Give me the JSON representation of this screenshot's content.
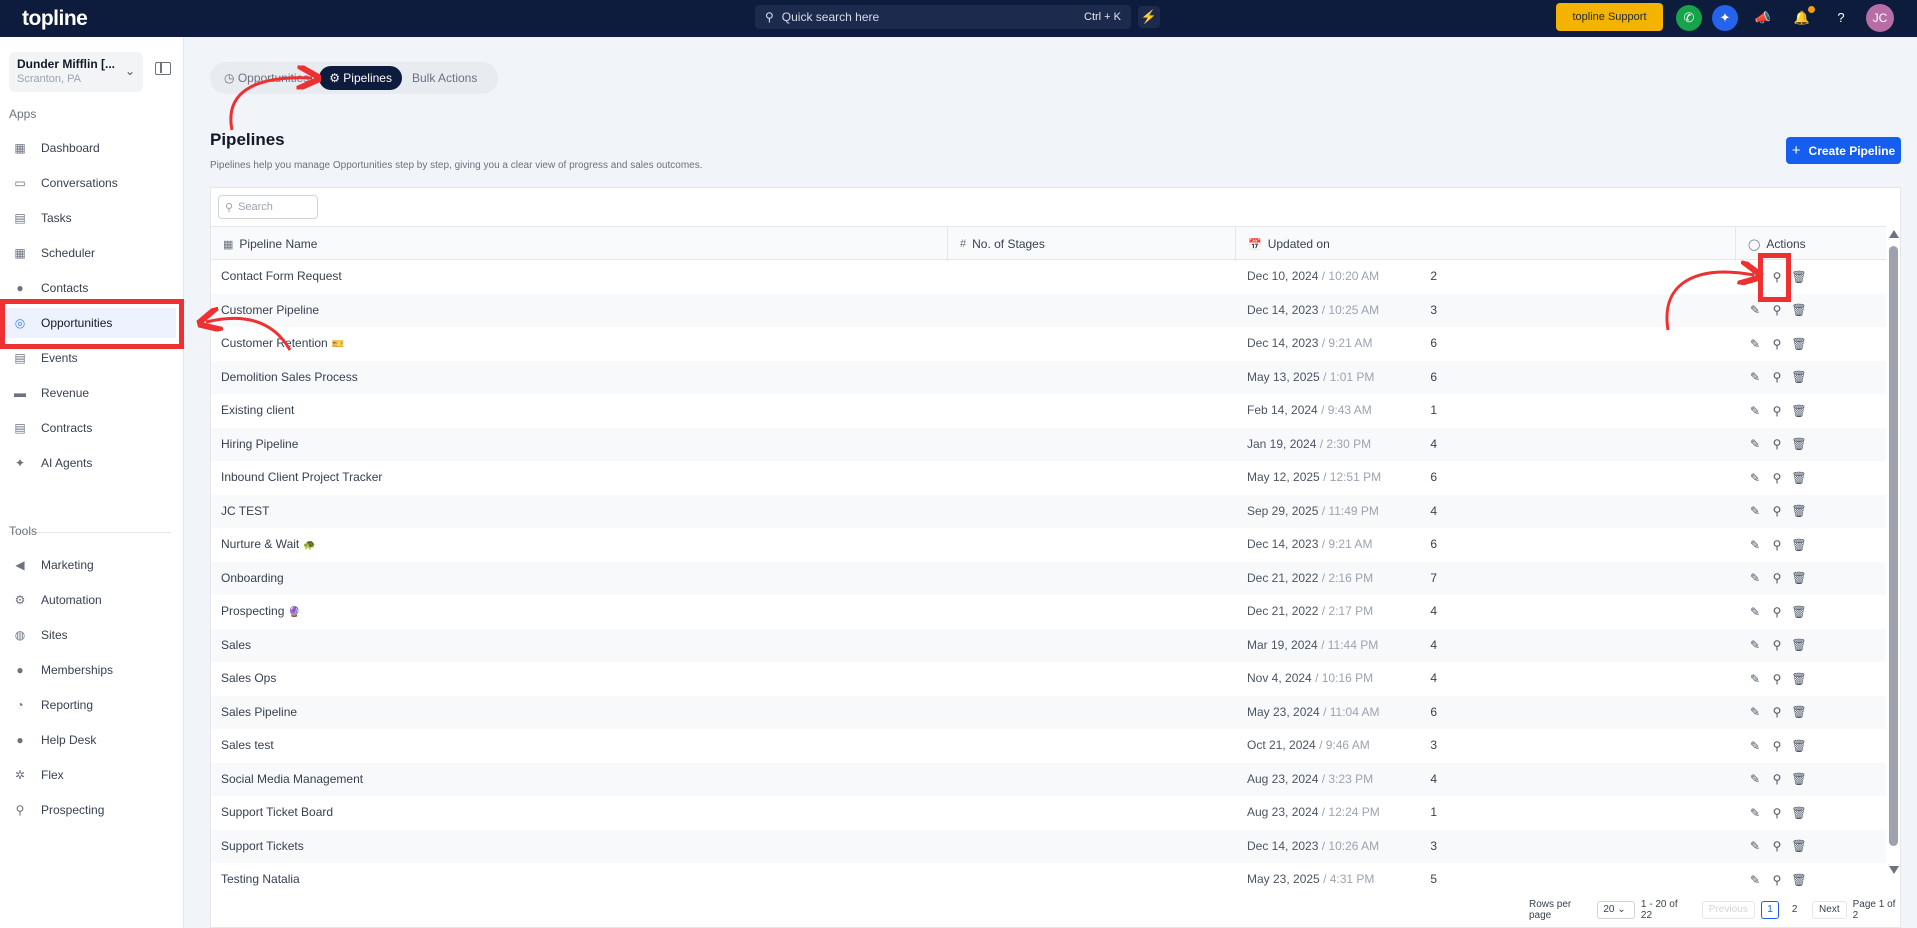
{
  "topbar": {
    "logo": "topline",
    "search_placeholder": "Quick search here",
    "search_shortcut": "Ctrl + K",
    "support_label": "topline Support",
    "avatar_initials": "JC"
  },
  "account": {
    "name": "Dunder Mifflin [...",
    "location": "Scranton, PA"
  },
  "sidebar": {
    "apps_label": "Apps",
    "tools_label": "Tools",
    "apps": [
      {
        "label": "Dashboard",
        "icon": "dashboard-icon"
      },
      {
        "label": "Conversations",
        "icon": "chat-icon"
      },
      {
        "label": "Tasks",
        "icon": "tasks-icon"
      },
      {
        "label": "Scheduler",
        "icon": "calendar-icon"
      },
      {
        "label": "Contacts",
        "icon": "person-icon"
      },
      {
        "label": "Opportunities",
        "icon": "target-icon"
      },
      {
        "label": "Events",
        "icon": "events-icon"
      },
      {
        "label": "Revenue",
        "icon": "card-icon"
      },
      {
        "label": "Contracts",
        "icon": "document-icon"
      },
      {
        "label": "AI Agents",
        "icon": "sparkle-icon"
      }
    ],
    "tools": [
      {
        "label": "Marketing",
        "icon": "megaphone-icon"
      },
      {
        "label": "Automation",
        "icon": "gears-icon"
      },
      {
        "label": "Sites",
        "icon": "globe-icon"
      },
      {
        "label": "Memberships",
        "icon": "people-icon"
      },
      {
        "label": "Reporting",
        "icon": "pie-icon"
      },
      {
        "label": "Help Desk",
        "icon": "help-icon"
      },
      {
        "label": "Flex",
        "icon": "flex-icon"
      },
      {
        "label": "Prospecting",
        "icon": "search-icon"
      }
    ]
  },
  "tabs": [
    {
      "label": "Opportunities"
    },
    {
      "label": "Pipelines"
    },
    {
      "label": "Bulk Actions"
    }
  ],
  "page": {
    "title": "Pipelines",
    "subtitle": "Pipelines help you manage Opportunities step by step, giving you a clear view of progress and sales outcomes.",
    "create_button": "Create Pipeline",
    "search_placeholder": "Search"
  },
  "table": {
    "headers": {
      "name": "Pipeline Name",
      "stages": "No. of Stages",
      "updated": "Updated on",
      "actions": "Actions"
    },
    "rows": [
      {
        "name": "Contact Form Request",
        "emoji": "",
        "stages": "2",
        "date": "Dec 10, 2024",
        "time": "10:20 AM"
      },
      {
        "name": "Customer Pipeline",
        "emoji": "",
        "stages": "3",
        "date": "Dec 14, 2023",
        "time": "10:25 AM"
      },
      {
        "name": "Customer Retention",
        "emoji": "🎫",
        "stages": "6",
        "date": "Dec 14, 2023",
        "time": "9:21 AM"
      },
      {
        "name": "Demolition Sales Process",
        "emoji": "",
        "stages": "6",
        "date": "May 13, 2025",
        "time": "1:01 PM"
      },
      {
        "name": "Existing client",
        "emoji": "",
        "stages": "1",
        "date": "Feb 14, 2024",
        "time": "9:43 AM"
      },
      {
        "name": "Hiring Pipeline",
        "emoji": "",
        "stages": "4",
        "date": "Jan 19, 2024",
        "time": "2:30 PM"
      },
      {
        "name": "Inbound Client Project Tracker",
        "emoji": "",
        "stages": "6",
        "date": "May 12, 2025",
        "time": "12:51 PM"
      },
      {
        "name": "JC TEST",
        "emoji": "",
        "stages": "4",
        "date": "Sep 29, 2025",
        "time": "11:49 PM"
      },
      {
        "name": "Nurture & Wait",
        "emoji": "🐢",
        "stages": "6",
        "date": "Dec 14, 2023",
        "time": "9:21 AM"
      },
      {
        "name": "Onboarding",
        "emoji": "",
        "stages": "7",
        "date": "Dec 21, 2022",
        "time": "2:16 PM"
      },
      {
        "name": "Prospecting",
        "emoji": "🔮",
        "stages": "4",
        "date": "Dec 21, 2022",
        "time": "2:17 PM"
      },
      {
        "name": "Sales",
        "emoji": "",
        "stages": "4",
        "date": "Mar 19, 2024",
        "time": "11:44 PM"
      },
      {
        "name": "Sales Ops",
        "emoji": "",
        "stages": "4",
        "date": "Nov 4, 2024",
        "time": "10:16 PM"
      },
      {
        "name": "Sales Pipeline",
        "emoji": "",
        "stages": "6",
        "date": "May 23, 2024",
        "time": "11:04 AM"
      },
      {
        "name": "Sales test",
        "emoji": "",
        "stages": "3",
        "date": "Oct 21, 2024",
        "time": "9:46 AM"
      },
      {
        "name": "Social Media Management",
        "emoji": "",
        "stages": "4",
        "date": "Aug 23, 2024",
        "time": "3:23 PM"
      },
      {
        "name": "Support Ticket Board",
        "emoji": "",
        "stages": "1",
        "date": "Aug 23, 2024",
        "time": "12:24 PM"
      },
      {
        "name": "Support Tickets",
        "emoji": "",
        "stages": "3",
        "date": "Dec 14, 2023",
        "time": "10:26 AM"
      },
      {
        "name": "Testing Natalia",
        "emoji": "",
        "stages": "5",
        "date": "May 23, 2025",
        "time": "4:31 PM"
      }
    ]
  },
  "pagination": {
    "rows_per_page_label": "Rows per page",
    "rows_per_page": "20",
    "range": "1 - 20 of 22",
    "previous": "Previous",
    "pages": [
      "1",
      "2"
    ],
    "next": "Next",
    "page_of": "Page 1 of 2"
  },
  "colors": {
    "topbar": "#0d1b3d",
    "accent": "#155eef",
    "support": "#f5b301",
    "annotation": "#ef3030"
  }
}
